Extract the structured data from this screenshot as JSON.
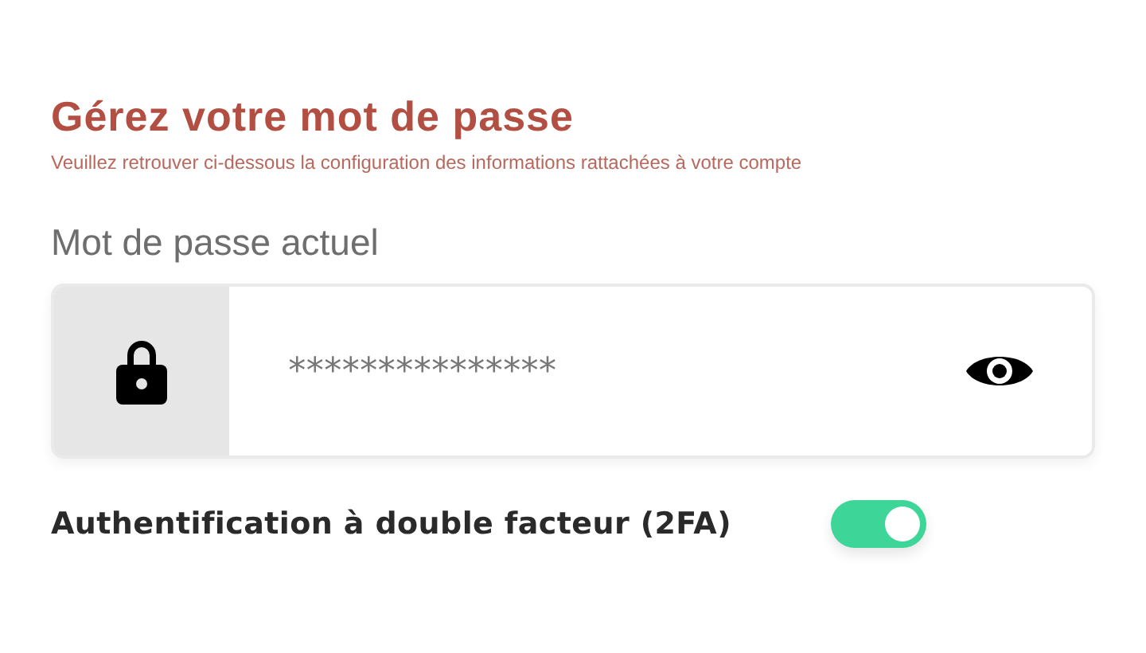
{
  "title": "Gérez votre mot de passe",
  "subtitle": "Veuillez retrouver ci-dessous la configuration des informations rattachées à votre  compte",
  "password_field": {
    "label": "Mot de passe actuel",
    "value": "***************"
  },
  "two_factor": {
    "label": "Authentification à double facteur (2FA)",
    "on": true
  }
}
